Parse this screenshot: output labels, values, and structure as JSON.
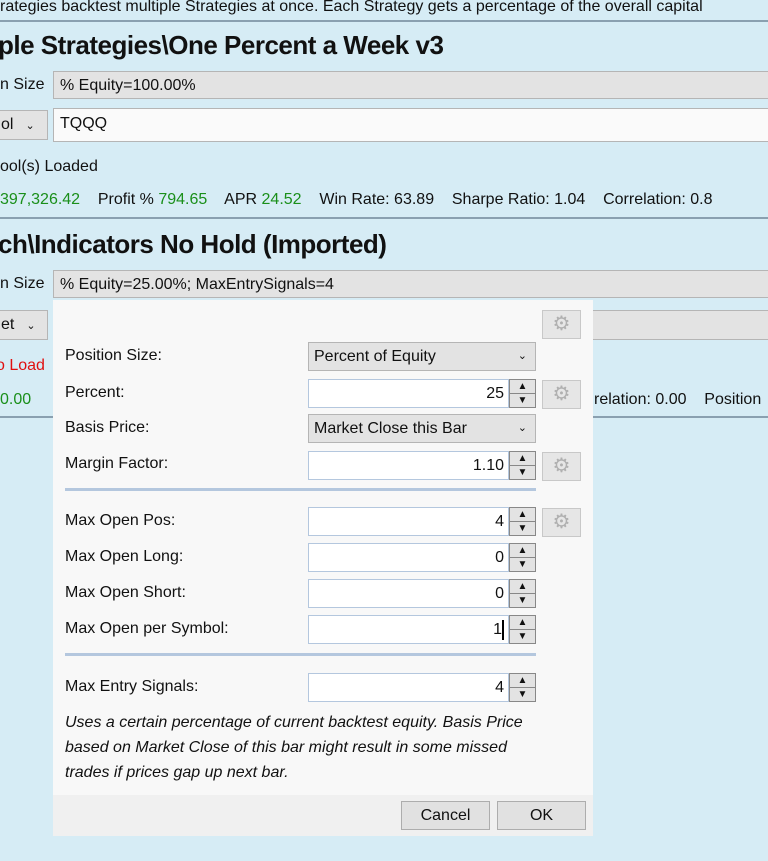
{
  "top_text": "rategies backtest multiple Strategies at once. Each Strategy gets a percentage of the overall capital",
  "strategy1": {
    "title": "ple Strategies\\One Percent a Week v3",
    "pos_size_label": "n Size",
    "pos_size_value": "% Equity=100.00%",
    "symbol_dropdown": "ol",
    "symbol_value": "TQQQ",
    "loaded_text": "ool(s) Loaded",
    "profit_value": "397,326.42",
    "profit_pct_label": "Profit %",
    "profit_pct": "794.65",
    "apr_label": "APR",
    "apr": "24.52",
    "win_rate": "Win Rate: 63.89",
    "sharpe": "Sharpe Ratio: 1.04",
    "correlation": "Correlation: 0.8"
  },
  "strategy2": {
    "title": "ch\\Indicators No Hold (Imported)",
    "pos_size_label": "n Size",
    "pos_size_value": "% Equity=25.00%; MaxEntrySignals=4",
    "dropdown": "et",
    "loaded_text": "o Load",
    "profit_value": "0.00",
    "correlation": "relation: 0.00",
    "position": "Position"
  },
  "dialog": {
    "position_size_label": "Position Size:",
    "position_size_value": "Percent of Equity",
    "percent_label": "Percent:",
    "percent_value": "25",
    "basis_price_label": "Basis Price:",
    "basis_price_value": "Market Close this Bar",
    "margin_label": "Margin Factor:",
    "margin_value": "1.10",
    "max_open_pos_label": "Max Open Pos:",
    "max_open_pos_value": "4",
    "max_open_long_label": "Max Open Long:",
    "max_open_long_value": "0",
    "max_open_short_label": "Max Open Short:",
    "max_open_short_value": "0",
    "max_open_symbol_label": "Max Open per Symbol:",
    "max_open_symbol_value": "1",
    "max_entry_label": "Max Entry Signals:",
    "max_entry_value": "4",
    "description": "Uses a certain percentage of current backtest equity. Basis Price based on Market Close of this bar might result in some missed trades if prices gap up next bar.",
    "cancel": "Cancel",
    "ok": "OK"
  }
}
